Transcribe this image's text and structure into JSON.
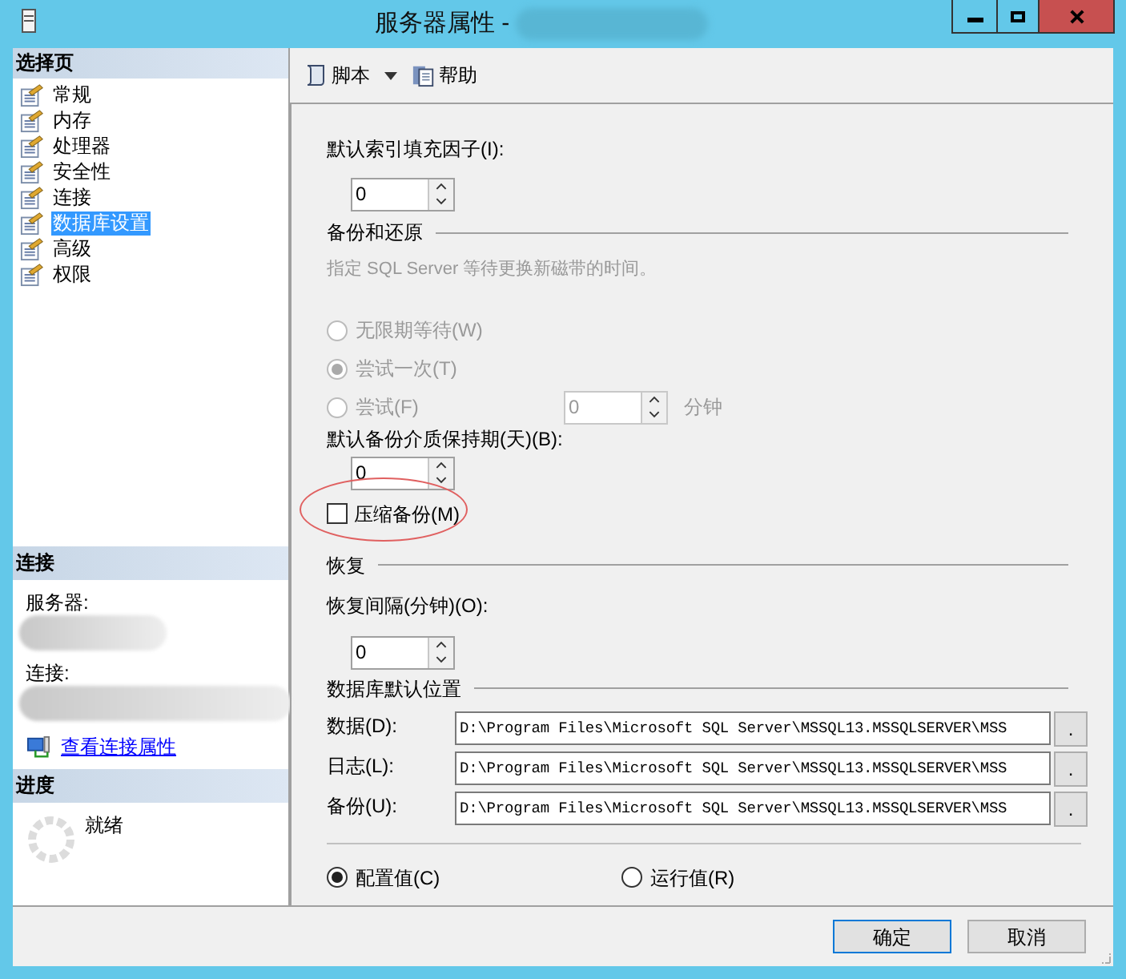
{
  "window": {
    "title": "服务器属性 -"
  },
  "sidebar": {
    "header": "选择页",
    "items": [
      {
        "label": "常规",
        "selected": false
      },
      {
        "label": "内存",
        "selected": false
      },
      {
        "label": "处理器",
        "selected": false
      },
      {
        "label": "安全性",
        "selected": false
      },
      {
        "label": "连接",
        "selected": false
      },
      {
        "label": "数据库设置",
        "selected": true
      },
      {
        "label": "高级",
        "selected": false
      },
      {
        "label": "权限",
        "selected": false
      }
    ]
  },
  "connection": {
    "header": "连接",
    "server_label": "服务器:",
    "connection_label": "连接:",
    "link": "查看连接属性"
  },
  "progress": {
    "header": "进度",
    "status": "就绪"
  },
  "toolbar": {
    "script": "脚本",
    "help": "帮助"
  },
  "settings": {
    "index_fill_label": "默认索引填充因子(I):",
    "index_fill_value": "0",
    "backup_section": "备份和还原",
    "backup_hint": "指定 SQL Server 等待更换新磁带的时间。",
    "tape_options": [
      {
        "label": "无限期等待(W)",
        "selected": false,
        "disabled": true
      },
      {
        "label": "尝试一次(T)",
        "selected": true,
        "disabled": true
      },
      {
        "label": "尝试(F)",
        "selected": false,
        "disabled": true,
        "spinner": "0",
        "unit": "分钟"
      }
    ],
    "retention_label": "默认备份介质保持期(天)(B):",
    "retention_value": "0",
    "compress": {
      "label": "压缩备份(M)",
      "checked": false
    },
    "recovery_section": "恢复",
    "recovery_label": "恢复间隔(分钟)(O):",
    "recovery_value": "0",
    "locations_section": "数据库默认位置",
    "locations": [
      {
        "label": "数据(D):",
        "value": "D:\\Program Files\\Microsoft SQL Server\\MSSQL13.MSSQLSERVER\\MSS",
        "browse": "."
      },
      {
        "label": "日志(L):",
        "value": "D:\\Program Files\\Microsoft SQL Server\\MSSQL13.MSSQLSERVER\\MSS",
        "browse": "."
      },
      {
        "label": "备份(U):",
        "value": "D:\\Program Files\\Microsoft SQL Server\\MSSQL13.MSSQLSERVER\\MSS",
        "browse": "."
      }
    ],
    "value_mode": [
      {
        "label": "配置值(C)",
        "selected": true
      },
      {
        "label": "运行值(R)",
        "selected": false
      }
    ]
  },
  "buttons": [
    {
      "label": "确定"
    },
    {
      "label": "取消"
    }
  ]
}
